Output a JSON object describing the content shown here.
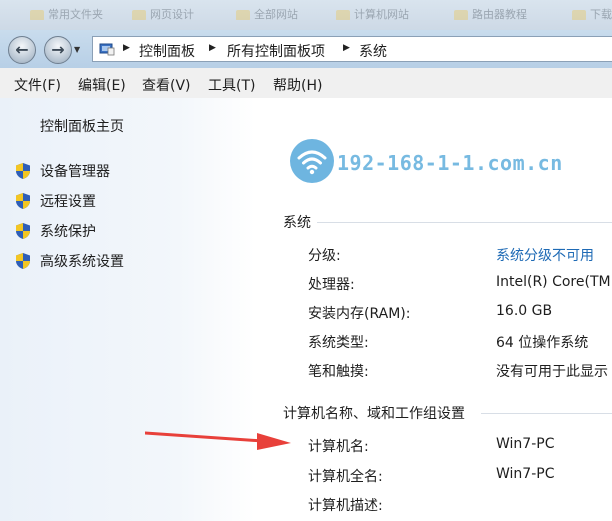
{
  "top_strip": {
    "items": [
      "常用文件夹",
      "网页设计",
      "全部网站",
      "计算机网站",
      "路由器教程",
      "下载"
    ]
  },
  "address_bar": {
    "crumbs": [
      "控制面板",
      "所有控制面板项",
      "系统"
    ]
  },
  "menu": {
    "items": [
      "文件(F)",
      "编辑(E)",
      "查看(V)",
      "工具(T)",
      "帮助(H)"
    ]
  },
  "left_pane": {
    "home_link": "控制面板主页",
    "tasks": [
      "设备管理器",
      "远程设置",
      "系统保护",
      "高级系统设置"
    ]
  },
  "watermark": {
    "text": "192-168-1-1.com.cn",
    "icon": "wifi-icon",
    "color": "#4aa3d8"
  },
  "system_section": {
    "title": "系统",
    "rows": [
      {
        "label": "分级:",
        "value": "系统分级不可用"
      },
      {
        "label": "处理器:",
        "value": "Intel(R) Core(TM"
      },
      {
        "label": "安装内存(RAM):",
        "value": "16.0 GB"
      },
      {
        "label": "系统类型:",
        "value": "64 位操作系统"
      },
      {
        "label": "笔和触摸:",
        "value": "没有可用于此显示"
      }
    ]
  },
  "computer_section": {
    "title": "计算机名称、域和工作组设置",
    "rows": [
      {
        "label": "计算机名:",
        "value": "Win7-PC"
      },
      {
        "label": "计算机全名:",
        "value": "Win7-PC"
      },
      {
        "label": "计算机描述:",
        "value": ""
      }
    ]
  },
  "colors": {
    "link": "#1e6ab5",
    "arrow": "#e8403a"
  }
}
